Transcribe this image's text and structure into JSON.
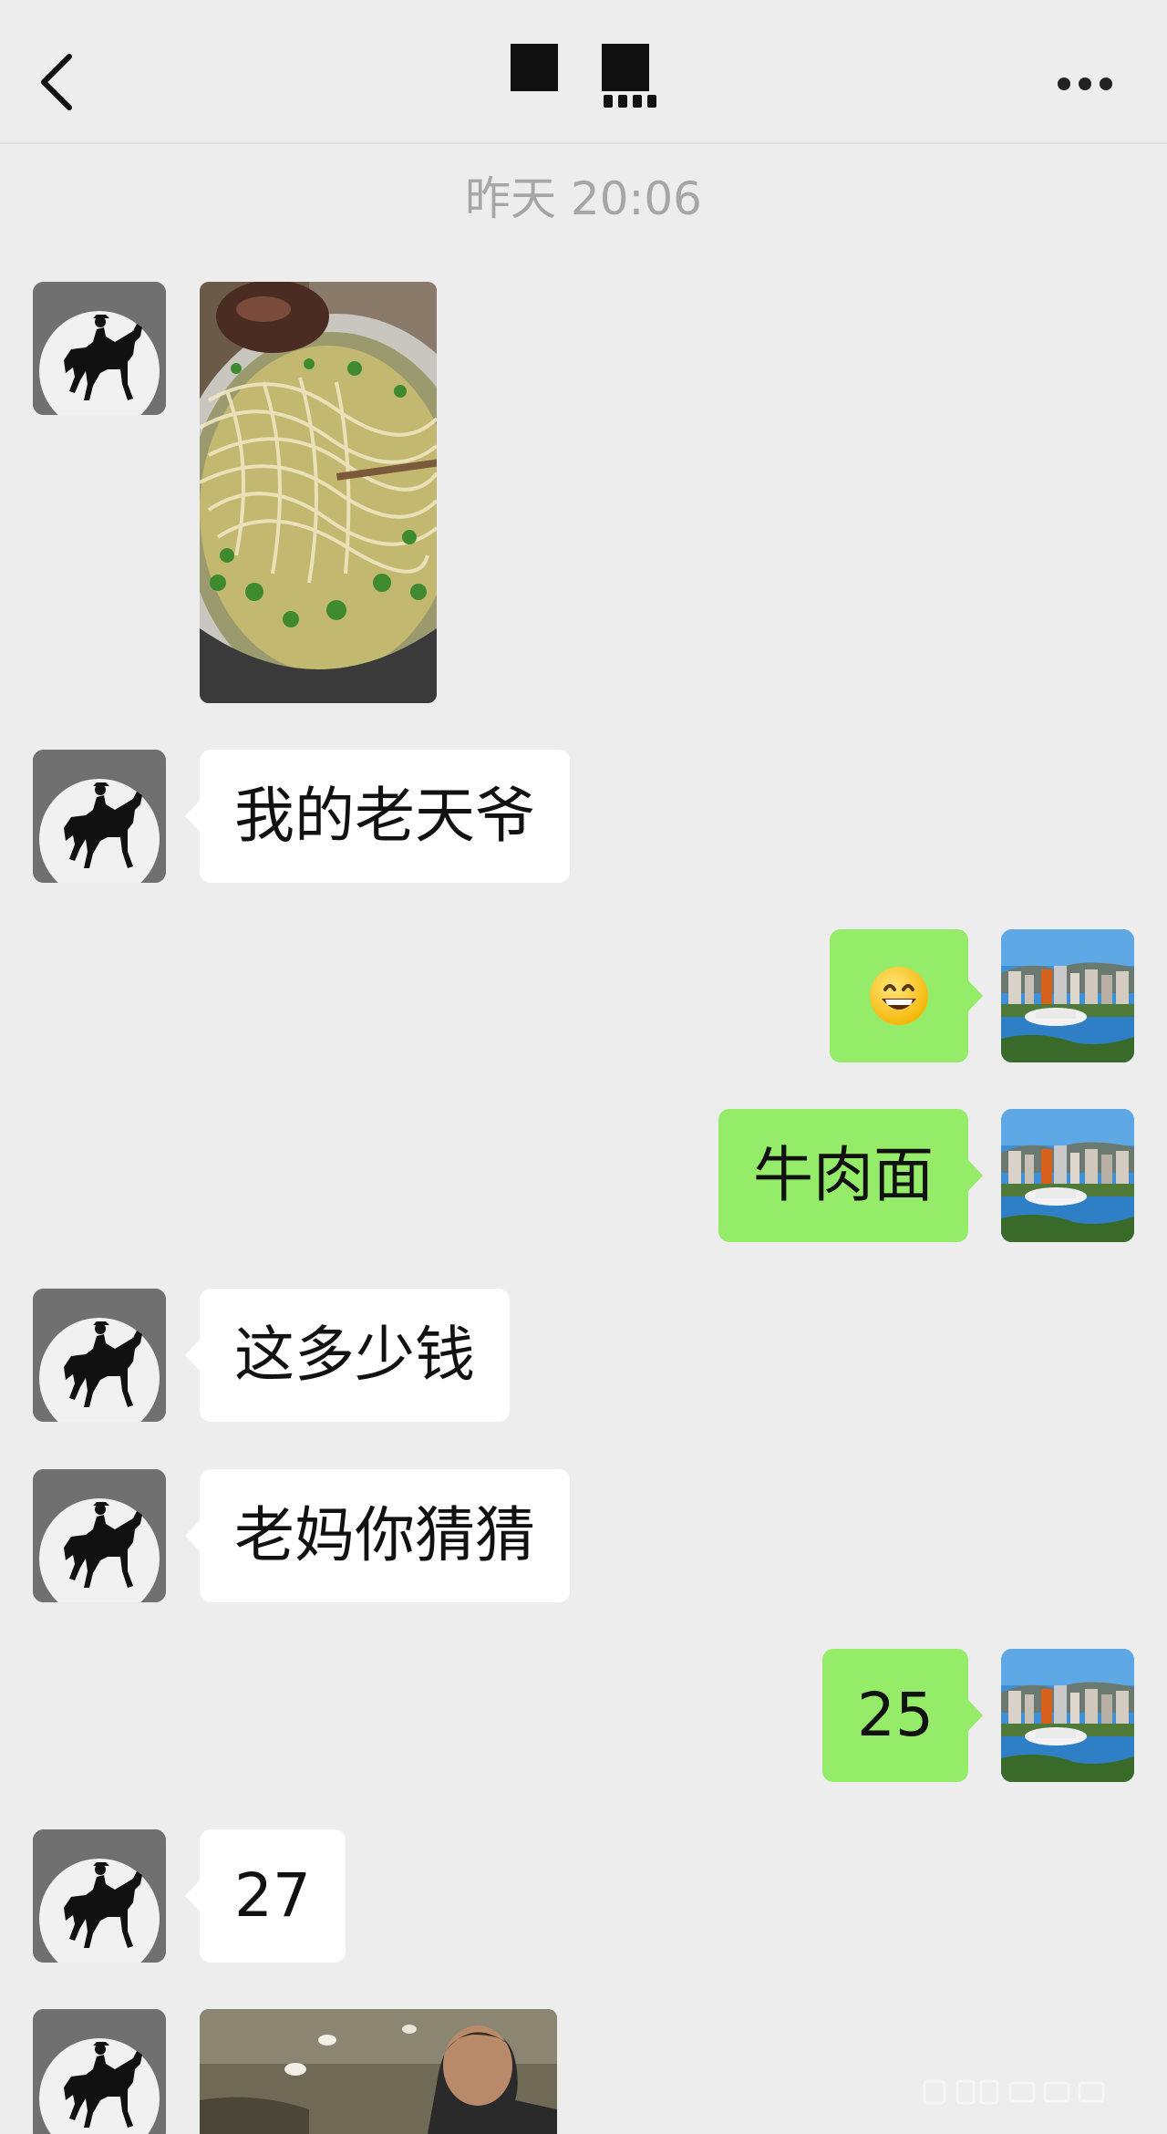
{
  "header": {
    "back_icon": "chevron-left-icon",
    "title_redacted": true,
    "more_icon": "more-dots-icon"
  },
  "timestamp": "昨天 20:06",
  "messages": [
    {
      "side": "left",
      "kind": "image",
      "description_icon": "noodle-bowl-photo"
    },
    {
      "side": "left",
      "kind": "text",
      "text": "我的老天爷"
    },
    {
      "side": "right",
      "kind": "emoji",
      "emoji": "grinning-face"
    },
    {
      "side": "right",
      "kind": "text",
      "text": "牛肉面"
    },
    {
      "side": "left",
      "kind": "text",
      "text": "这多少钱"
    },
    {
      "side": "left",
      "kind": "text",
      "text": "老妈你猜猜"
    },
    {
      "side": "right",
      "kind": "text",
      "text": "25"
    },
    {
      "side": "left",
      "kind": "text",
      "text": "27"
    },
    {
      "side": "left",
      "kind": "image",
      "description_icon": "man-video-still"
    }
  ],
  "colors": {
    "background": "#ededed",
    "bubble_self": "#95ec69",
    "bubble_other": "#ffffff",
    "timestamp": "#a6a6a6"
  }
}
